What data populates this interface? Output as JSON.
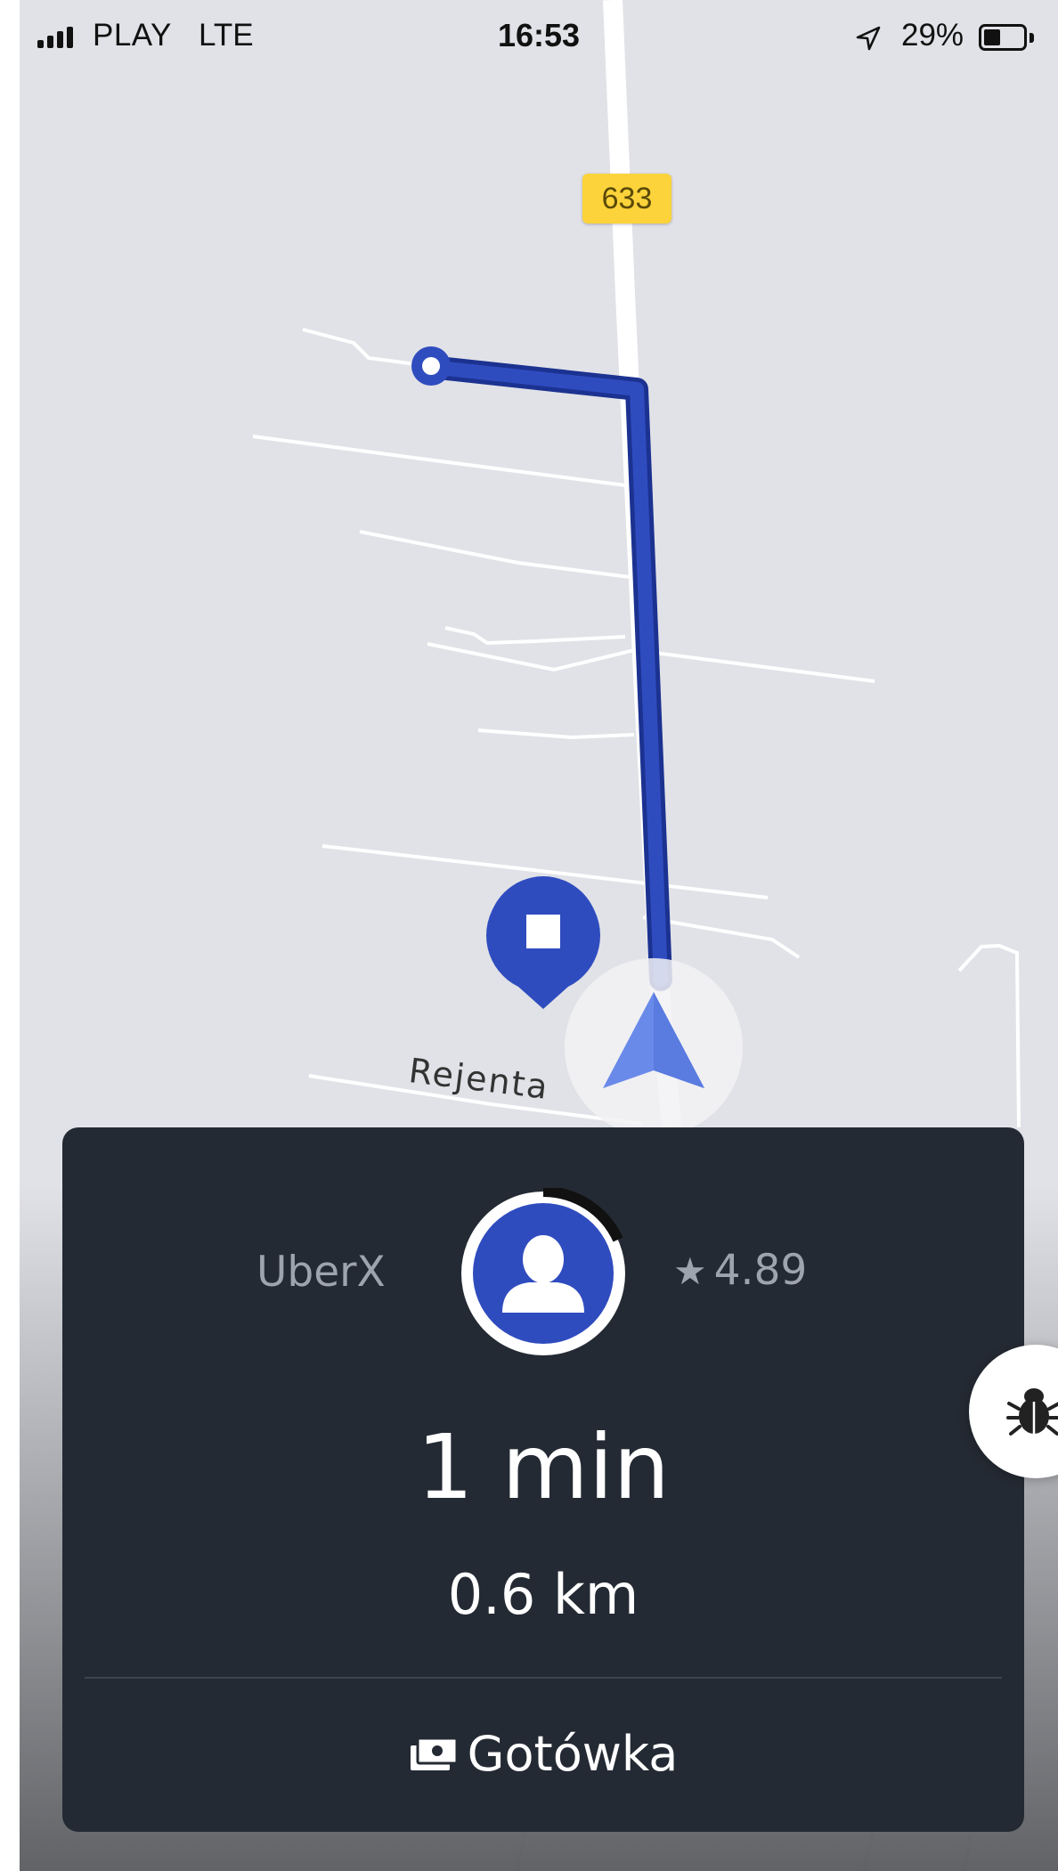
{
  "status_bar": {
    "carrier": "PLAY",
    "network": "LTE",
    "time": "16:53",
    "battery_percent_label": "29%",
    "battery_level": 0.29,
    "location_icon": "location-arrow-icon",
    "signal_icon": "cellular-signal-icon"
  },
  "map": {
    "road_number": "633",
    "street_name": "Rejenta",
    "route_color": "#2f4cbf",
    "pin_icon": "destination-pin-icon",
    "nav_icon": "navigation-arrow-icon"
  },
  "trip_card": {
    "vehicle_type": "UberX",
    "rating_star": "★",
    "rating": "4.89",
    "avatar_icon": "person-avatar-icon",
    "eta": "1 min",
    "distance": "0.6 km",
    "payment_icon": "cash-icon",
    "payment_method": "Gotówka",
    "background_color": "#242a33",
    "accent_color": "#2f4cbf"
  },
  "debug_button": {
    "icon": "bug-icon"
  }
}
